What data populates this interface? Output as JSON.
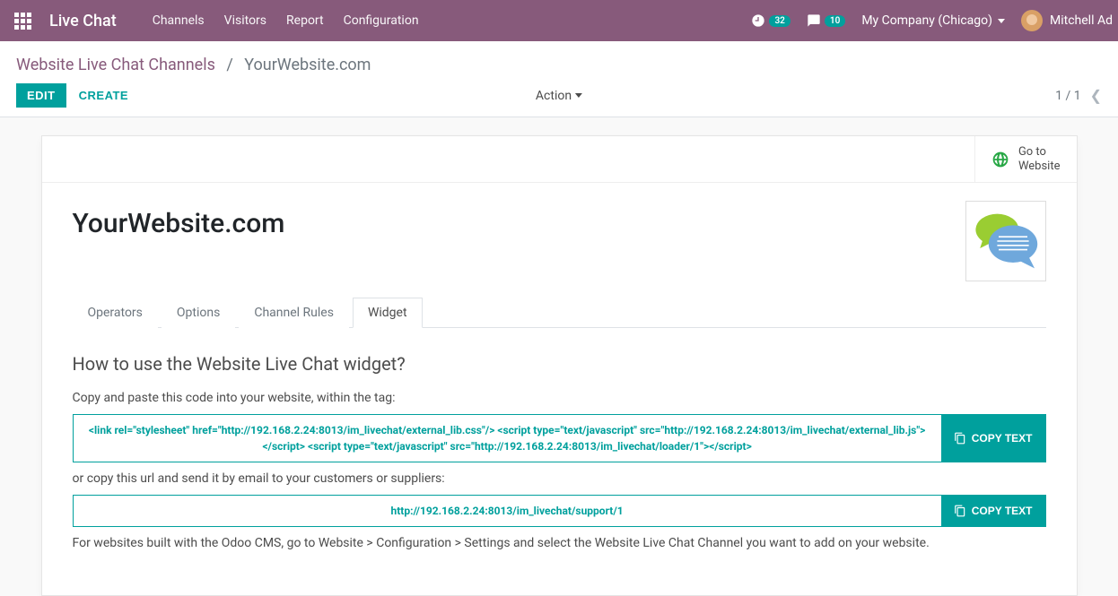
{
  "navbar": {
    "app_name": "Live Chat",
    "menu": [
      "Channels",
      "Visitors",
      "Report",
      "Configuration"
    ],
    "activity_count": "32",
    "discuss_count": "10",
    "company": "My Company (Chicago)",
    "user_name": "Mitchell Ad"
  },
  "breadcrumb": {
    "parent": "Website Live Chat Channels",
    "current": "YourWebsite.com"
  },
  "control_panel": {
    "edit": "EDIT",
    "create": "CREATE",
    "action": "Action",
    "pager": "1 / 1"
  },
  "statusbar": {
    "go_website_line1": "Go to",
    "go_website_line2": "Website"
  },
  "record": {
    "title": "YourWebsite.com"
  },
  "tabs": {
    "items": [
      "Operators",
      "Options",
      "Channel Rules",
      "Widget"
    ],
    "active_index": 3
  },
  "widget_tab": {
    "heading": "How to use the Website Live Chat widget?",
    "p1": "Copy and paste this code into your website, within the tag:",
    "code1_line1": "<link rel=\"stylesheet\" href=\"http://192.168.2.24:8013/im_livechat/external_lib.css\"/> <script type=\"text/javascript\" src=\"http://192.168.2.24:8013/im_livechat/external_lib.js\">",
    "code1_line2": "</script> <script type=\"text/javascript\" src=\"http://192.168.2.24:8013/im_livechat/loader/1\"></script>",
    "copy_label": "COPY TEXT",
    "p2": "or copy this url and send it by email to your customers or suppliers:",
    "code2": "http://192.168.2.24:8013/im_livechat/support/1",
    "p3": "For websites built with the Odoo CMS, go to Website > Configuration > Settings and select the Website Live Chat Channel you want to add on your website."
  }
}
